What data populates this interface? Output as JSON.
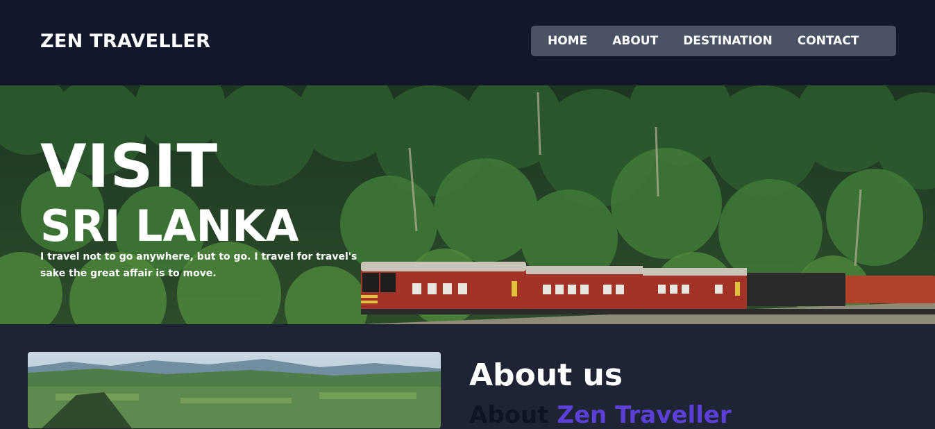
{
  "header": {
    "logo": "ZEN TRAVELLER",
    "nav": [
      {
        "label": "HOME"
      },
      {
        "label": "ABOUT"
      },
      {
        "label": "DESTINATION"
      },
      {
        "label": "CONTACT"
      }
    ]
  },
  "hero": {
    "title_line1": "VISIT",
    "title_line2": "SRI LANKA",
    "tagline": "I travel not to go anywhere, but to go. I travel for travel's sake the great affair is to move."
  },
  "about": {
    "heading": "About us",
    "sub_prefix": "About ",
    "sub_accent": "Zen Traveller"
  },
  "colors": {
    "header_bg": "#121829",
    "nav_bg": "#4a5263",
    "page_bg": "#1e2433",
    "accent": "#5b3fd6"
  }
}
